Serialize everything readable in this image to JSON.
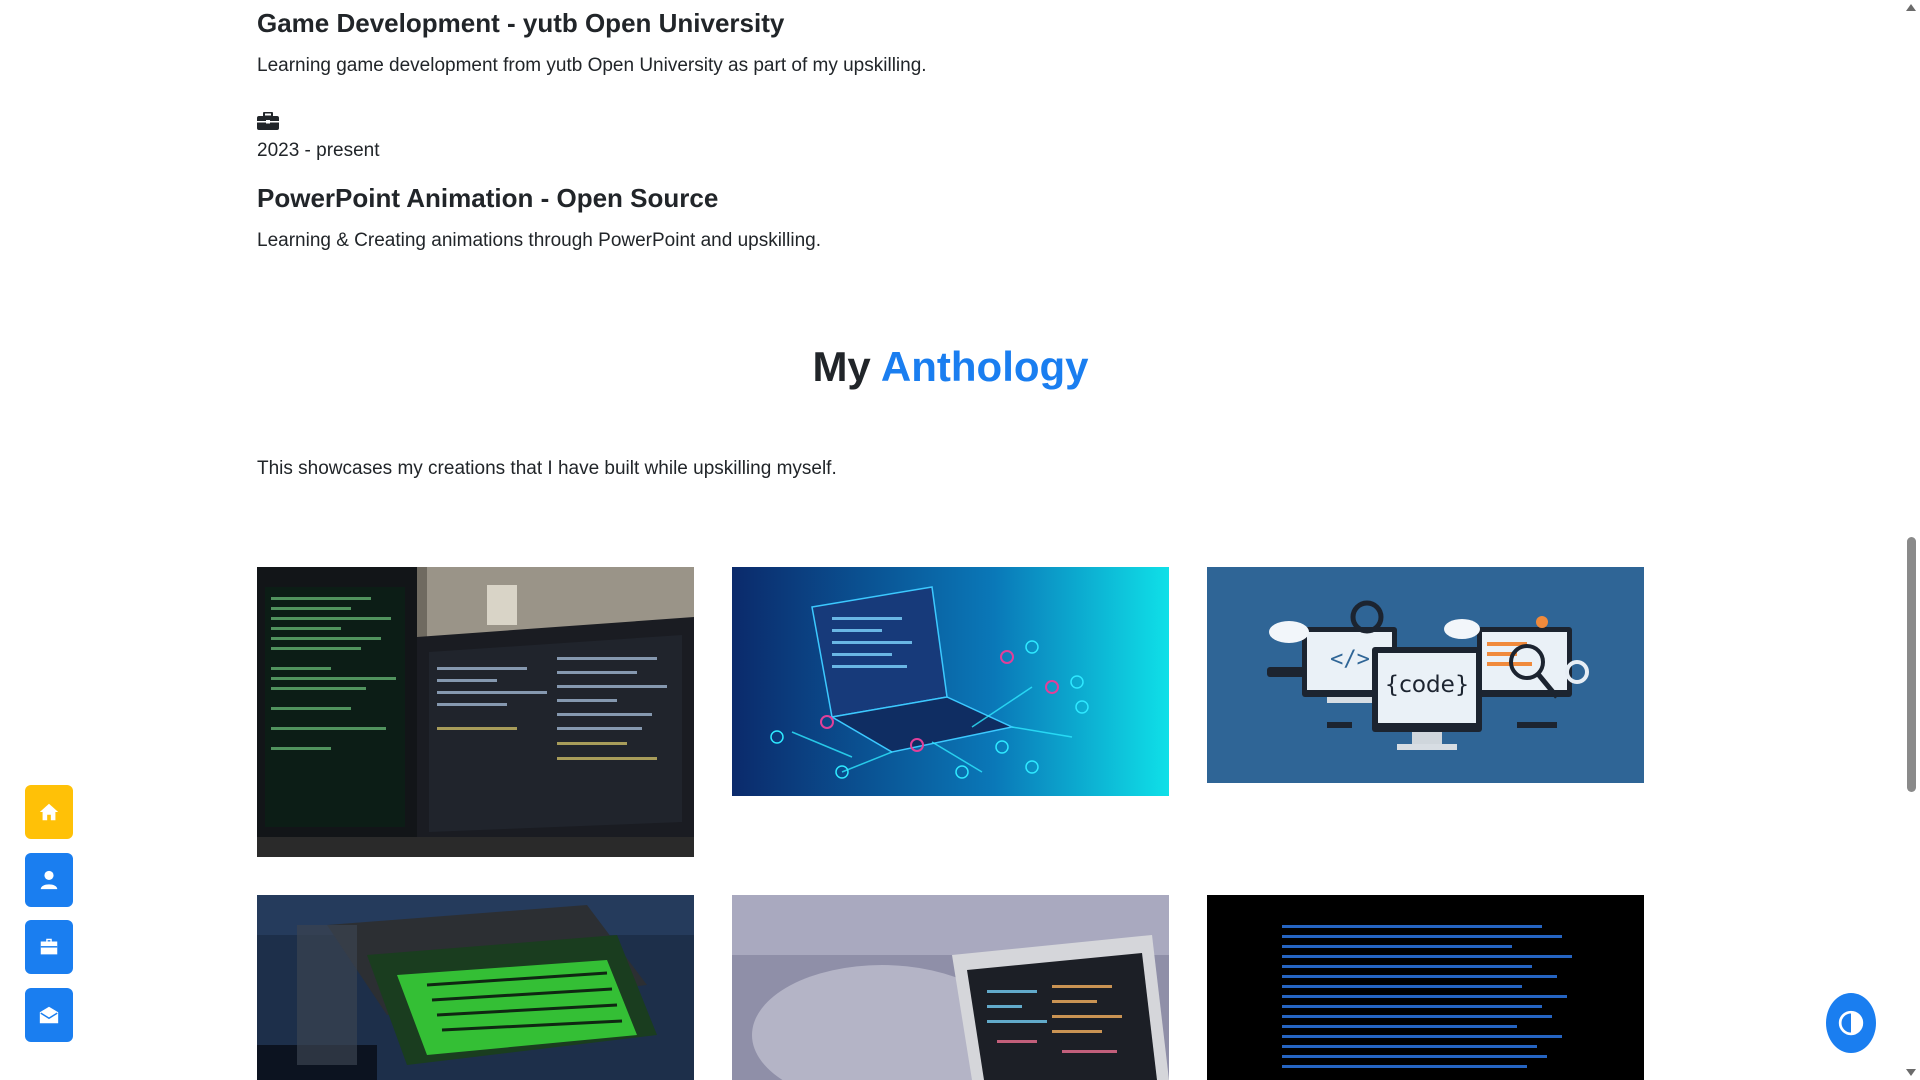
{
  "experience": [
    {
      "title": "Game Development - yutb Open University",
      "description": "Learning game development from yutb Open University as part of my upskilling."
    },
    {
      "date": "2023 - present",
      "title": "PowerPoint Animation - Open Source",
      "description": "Learning & Creating animations through PowerPoint and upskilling."
    }
  ],
  "anthology": {
    "title_prefix": "My",
    "title_accent": "Anthology",
    "intro": "This showcases my creations that I have built while upskilling myself.",
    "code_label": "{code}",
    "tag_label": "</>"
  },
  "dock": {
    "home_color": "#ffc107",
    "button_color": "#1a7ef0",
    "items": [
      "home-icon",
      "user-icon",
      "briefcase-icon",
      "envelope-icon"
    ]
  },
  "theme_toggle": {
    "icon": "contrast-icon",
    "color": "#1a7ef0"
  }
}
